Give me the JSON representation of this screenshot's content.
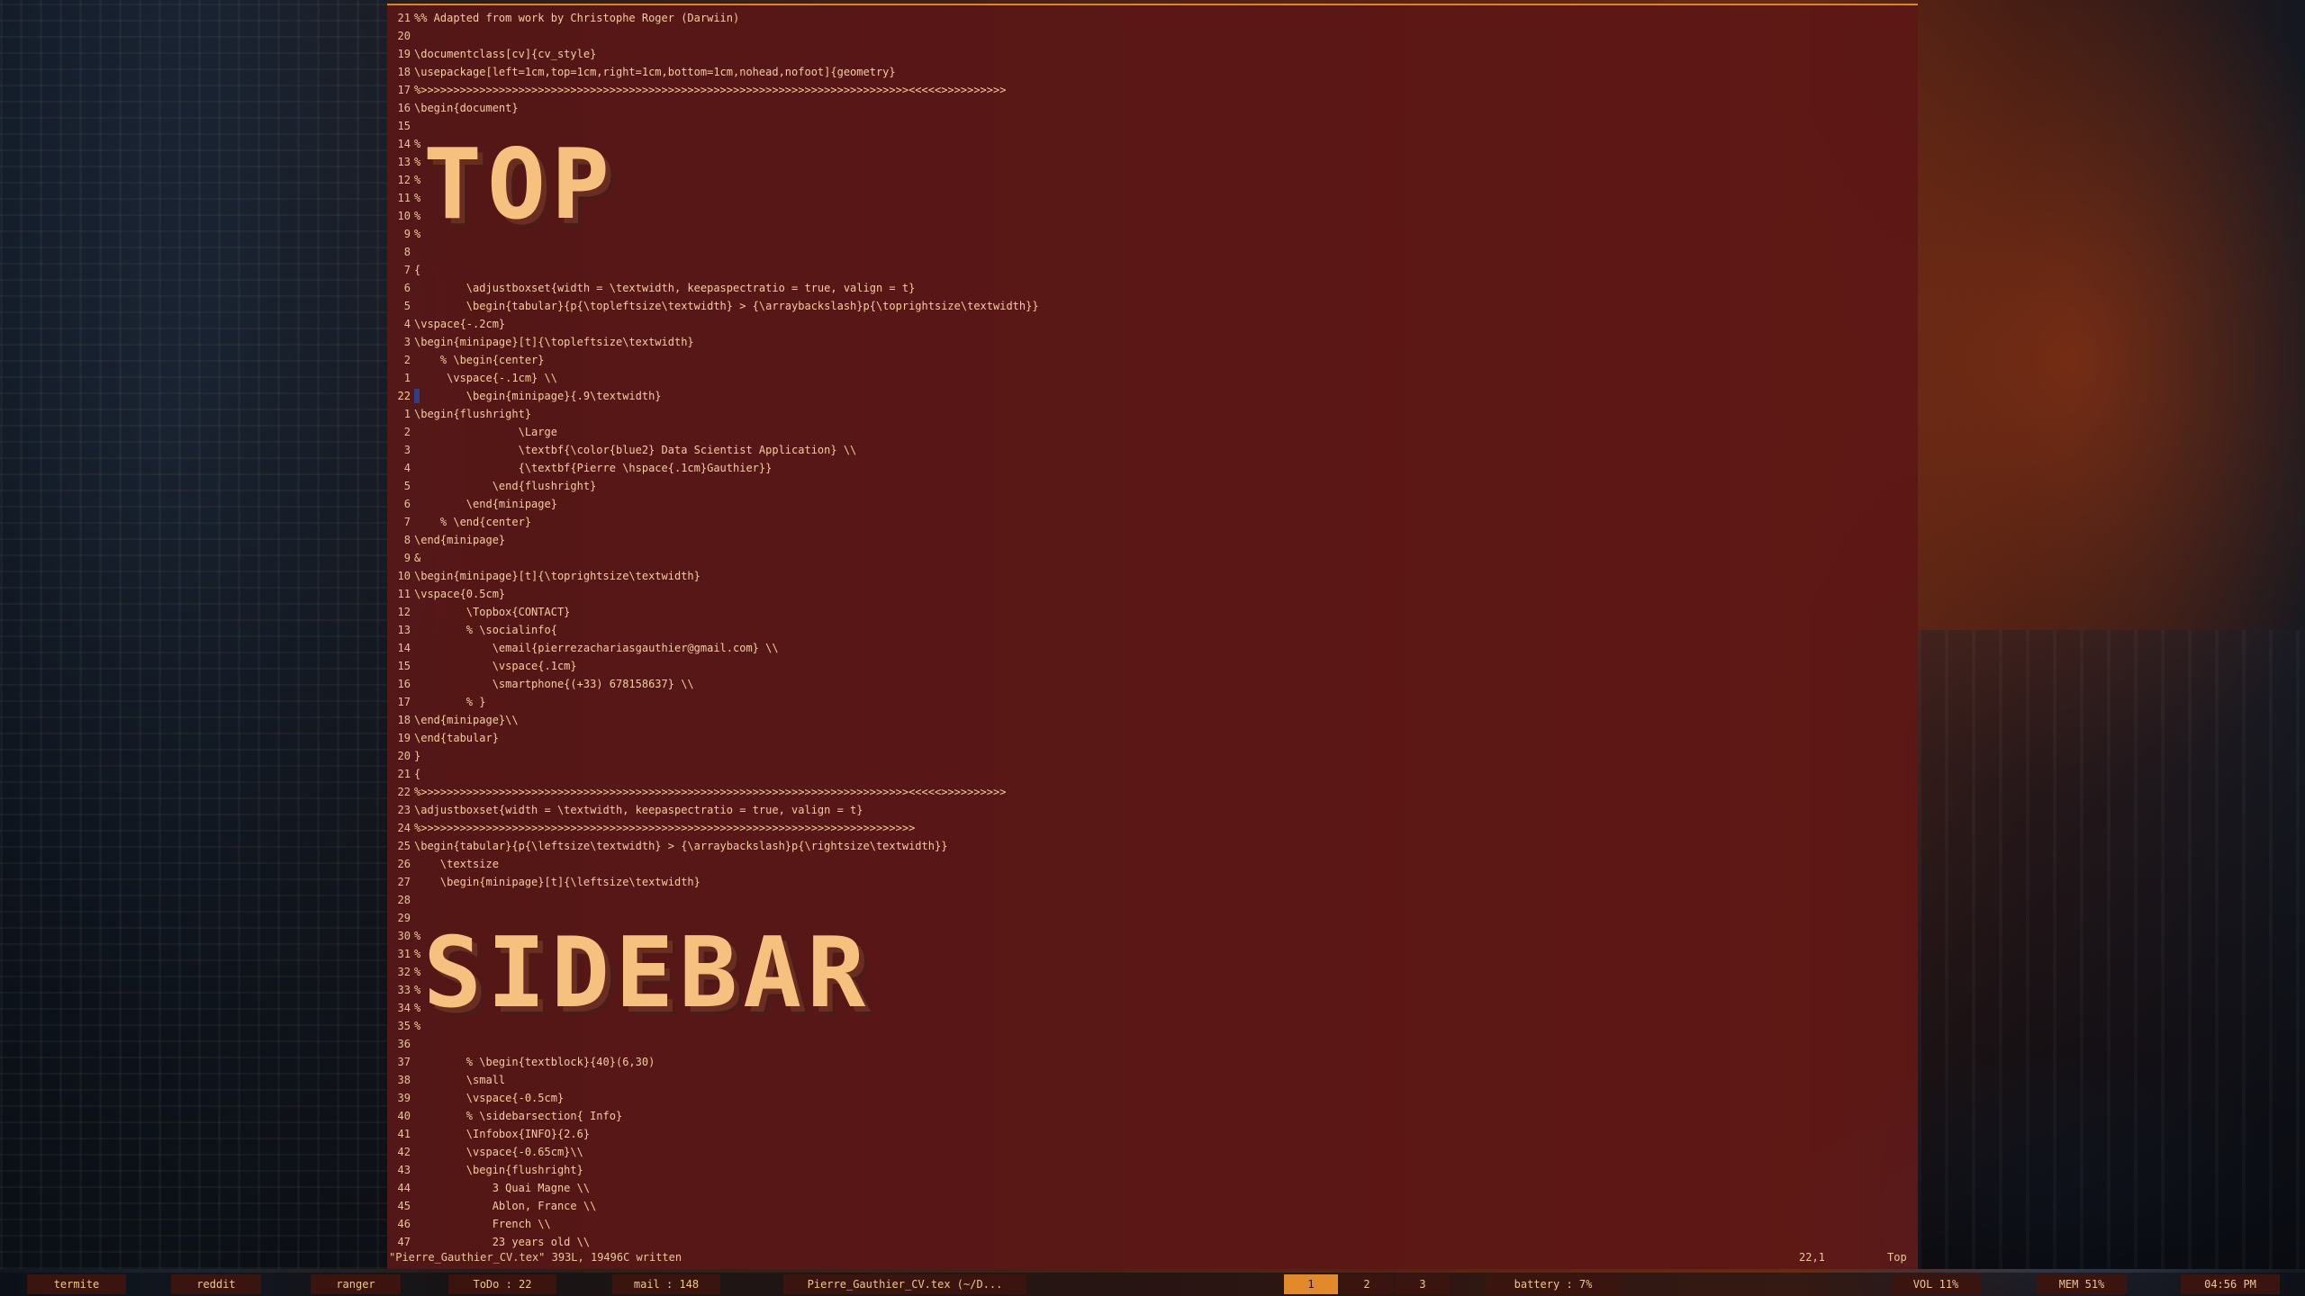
{
  "editor": {
    "lines": [
      {
        "n": "21",
        "t": "%% Adapted from work by Christophe Roger (Darwiin)"
      },
      {
        "n": "20",
        "t": ""
      },
      {
        "n": "19",
        "t": "\\documentclass[cv]{cv_style}"
      },
      {
        "n": "18",
        "t": "\\usepackage[left=1cm,top=1cm,right=1cm,bottom=1cm,nohead,nofoot]{geometry}"
      },
      {
        "n": "17",
        "t": "%>>>>>>>>>>>>>>>>>>>>>>>>>>>>>>>>>>>>>>>>>>>>>>>>>>>>>>>>>>>>>>>>>>>>>>>>>>><<<<<>>>>>>>>>>"
      },
      {
        "n": "16",
        "t": "\\begin{document}"
      },
      {
        "n": "15",
        "t": ""
      },
      {
        "n": "14",
        "t": "%"
      },
      {
        "n": "13",
        "t": "%"
      },
      {
        "n": "12",
        "t": "%"
      },
      {
        "n": "11",
        "t": "%"
      },
      {
        "n": "10",
        "t": "%"
      },
      {
        "n": "9",
        "t": "%"
      },
      {
        "n": "8",
        "t": ""
      },
      {
        "n": "7",
        "t": "{"
      },
      {
        "n": "6",
        "t": "        \\adjustboxset{width = \\textwidth, keepaspectratio = true, valign = t}"
      },
      {
        "n": "5",
        "t": "        \\begin{tabular}{p{\\topleftsize\\textwidth} > {\\arraybackslash}p{\\toprightsize\\textwidth}}"
      },
      {
        "n": "4",
        "t": "\\vspace{-.2cm}"
      },
      {
        "n": "3",
        "t": "\\begin{minipage}[t]{\\topleftsize\\textwidth}"
      },
      {
        "n": "2",
        "t": "    % \\begin{center}"
      },
      {
        "n": "1",
        "t": "     \\vspace{-.1cm} \\\\"
      },
      {
        "n": "22",
        "t": "        \\begin{minipage}{.9\\textwidth}",
        "cur": true
      },
      {
        "n": "1",
        "t": "\\begin{flushright}"
      },
      {
        "n": "2",
        "t": "                \\Large"
      },
      {
        "n": "3",
        "t": "                \\textbf{\\color{blue2} Data Scientist Application} \\\\"
      },
      {
        "n": "4",
        "t": "                {\\textbf{Pierre \\hspace{.1cm}Gauthier}}"
      },
      {
        "n": "5",
        "t": "            \\end{flushright}"
      },
      {
        "n": "6",
        "t": "        \\end{minipage}"
      },
      {
        "n": "7",
        "t": "    % \\end{center}"
      },
      {
        "n": "8",
        "t": "\\end{minipage}"
      },
      {
        "n": "9",
        "t": "&"
      },
      {
        "n": "10",
        "t": "\\begin{minipage}[t]{\\toprightsize\\textwidth}"
      },
      {
        "n": "11",
        "t": "\\vspace{0.5cm}"
      },
      {
        "n": "12",
        "t": "        \\Topbox{CONTACT}"
      },
      {
        "n": "13",
        "t": "        % \\socialinfo{"
      },
      {
        "n": "14",
        "t": "            \\email{pierrezachariasgauthier@gmail.com} \\\\"
      },
      {
        "n": "15",
        "t": "            \\vspace{.1cm}"
      },
      {
        "n": "16",
        "t": "            \\smartphone{(+33) 678158637} \\\\"
      },
      {
        "n": "17",
        "t": "        % }"
      },
      {
        "n": "18",
        "t": "\\end{minipage}\\\\"
      },
      {
        "n": "19",
        "t": "\\end{tabular}"
      },
      {
        "n": "20",
        "t": "}"
      },
      {
        "n": "21",
        "t": "{"
      },
      {
        "n": "22",
        "t": "%>>>>>>>>>>>>>>>>>>>>>>>>>>>>>>>>>>>>>>>>>>>>>>>>>>>>>>>>>>>>>>>>>>>>>>>>>>><<<<<>>>>>>>>>>"
      },
      {
        "n": "23",
        "t": "\\adjustboxset{width = \\textwidth, keepaspectratio = true, valign = t}"
      },
      {
        "n": "24",
        "t": "%>>>>>>>>>>>>>>>>>>>>>>>>>>>>>>>>>>>>>>>>>>>>>>>>>>>>>>>>>>>>>>>>>>>>>>>>>>>>"
      },
      {
        "n": "25",
        "t": "\\begin{tabular}{p{\\leftsize\\textwidth} > {\\arraybackslash}p{\\rightsize\\textwidth}}"
      },
      {
        "n": "26",
        "t": "    \\textsize"
      },
      {
        "n": "27",
        "t": "    \\begin{minipage}[t]{\\leftsize\\textwidth}"
      },
      {
        "n": "28",
        "t": ""
      },
      {
        "n": "29",
        "t": ""
      },
      {
        "n": "30",
        "t": "%"
      },
      {
        "n": "31",
        "t": "%"
      },
      {
        "n": "32",
        "t": "%"
      },
      {
        "n": "33",
        "t": "%"
      },
      {
        "n": "34",
        "t": "%"
      },
      {
        "n": "35",
        "t": "%"
      },
      {
        "n": "36",
        "t": ""
      },
      {
        "n": "37",
        "t": "        % \\begin{textblock}{40}(6,30)"
      },
      {
        "n": "38",
        "t": "        \\small"
      },
      {
        "n": "39",
        "t": "        \\vspace{-0.5cm}"
      },
      {
        "n": "40",
        "t": "        % \\sidebarsection{ Info}"
      },
      {
        "n": "41",
        "t": "        \\Infobox{INFO}{2.6}"
      },
      {
        "n": "42",
        "t": "        \\vspace{-0.65cm}\\\\"
      },
      {
        "n": "43",
        "t": "        \\begin{flushright}"
      },
      {
        "n": "44",
        "t": "            3 Quai Magne \\\\"
      },
      {
        "n": "45",
        "t": "            Ablon, France \\\\"
      },
      {
        "n": "46",
        "t": "            French \\\\"
      },
      {
        "n": "47",
        "t": "            23 years old \\\\"
      }
    ],
    "ascii_top": "TOP",
    "ascii_sidebar": "SIDEBAR",
    "status_message": "\"Pierre_Gauthier_CV.tex\" 393L, 19496C written",
    "cursor_position": "22,1",
    "scroll_position": "Top"
  },
  "taskbar": {
    "termite": "termite",
    "reddit": "reddit",
    "ranger": "ranger",
    "todo": "ToDo : 22",
    "mail": "mail :  148",
    "window_title": "Pierre_Gauthier_CV.tex (~/D...",
    "ws1": "1",
    "ws2": "2",
    "ws3": "3",
    "battery": "battery : 7%",
    "volume": "VOL 11%",
    "memory": "MEM 51%",
    "clock": "04:56 PM"
  },
  "colors": {
    "editor_bg": "#5c1616",
    "accent": "#e2892c",
    "text": "#f2cf9e"
  }
}
